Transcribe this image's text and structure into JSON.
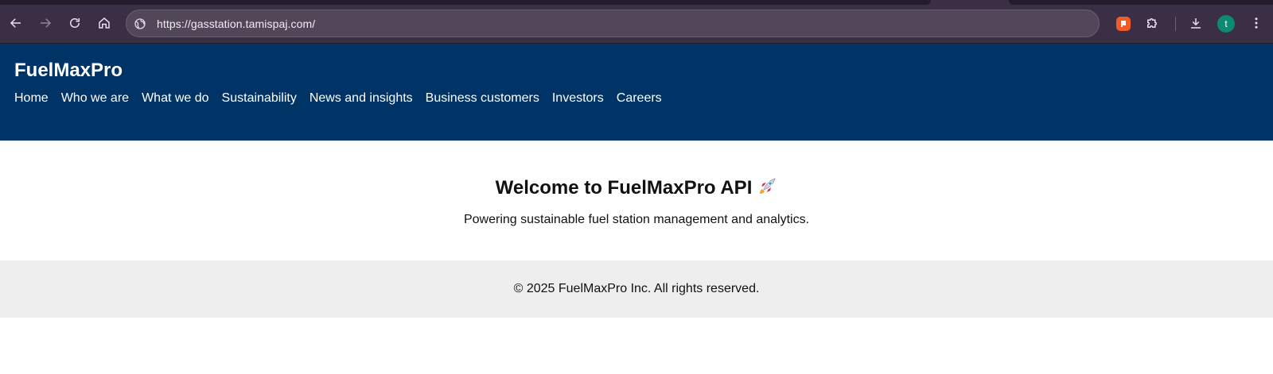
{
  "browser": {
    "url": "https://gasstation.tamispaj.com/",
    "profile_initial": "t",
    "icons": {
      "back": "arrow-left-icon",
      "forward": "arrow-right-icon",
      "reload": "reload-icon",
      "home": "home-icon",
      "site_info": "globe-icon",
      "extension": "flag-extension-icon",
      "extensions_menu": "puzzle-icon",
      "downloads": "download-icon",
      "menu": "kebab-menu-icon"
    },
    "colors": {
      "chrome": "#3a2f45",
      "omnibox": "#524759",
      "avatar": "#0d8a74",
      "extension": "#f25a2a"
    }
  },
  "site": {
    "brand": "FuelMaxPro",
    "nav": [
      "Home",
      "Who we are",
      "What we do",
      "Sustainability",
      "News and insights",
      "Business customers",
      "Investors",
      "Careers"
    ],
    "colors": {
      "header": "#003366",
      "footer": "#eeeeee"
    }
  },
  "main": {
    "title": "Welcome to FuelMaxPro API",
    "title_icon": "rocket-icon",
    "tagline": "Powering sustainable fuel station management and analytics."
  },
  "footer": {
    "copyright": "© 2025 FuelMaxPro Inc. All rights reserved."
  }
}
